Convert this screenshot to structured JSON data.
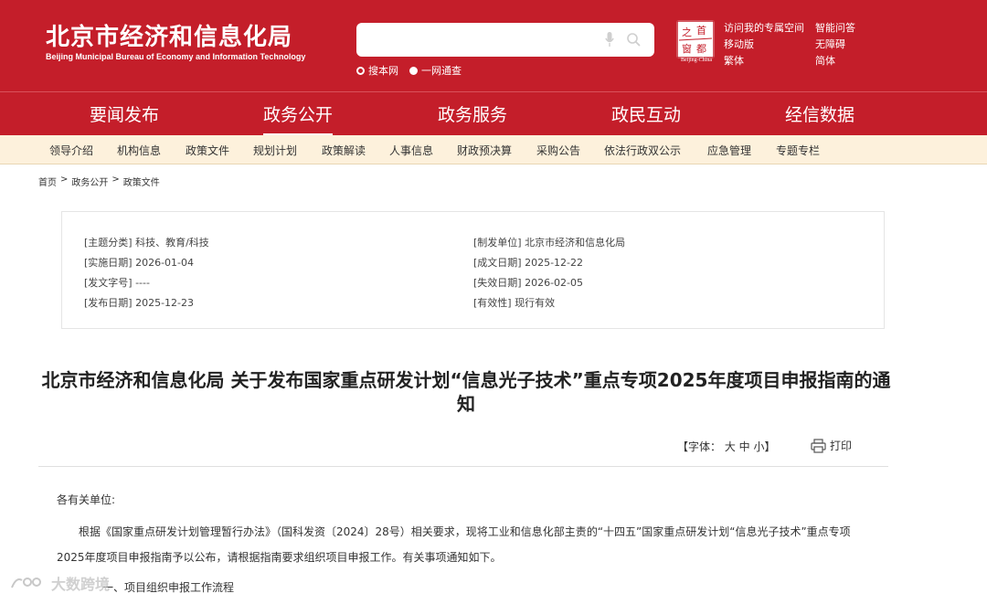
{
  "header": {
    "title_cn": "北京市经济和信息化局",
    "title_en": "Beijing Municipal Bureau of Economy and Information Technology",
    "search": {
      "placeholder": "",
      "options": [
        "搜本网",
        "一网通查"
      ]
    },
    "seal_caption": "Beijing-China",
    "top_links": [
      "访问我的专属空间",
      "智能问答",
      "移动版",
      "无障碍",
      "繁体",
      "简体"
    ],
    "colors": {
      "brand_red": "#c41e2a",
      "subnav_bg": "#fdf1dc"
    }
  },
  "main_nav": [
    "要闻发布",
    "政务公开",
    "政务服务",
    "政民互动",
    "经信数据"
  ],
  "sub_nav": [
    "领导介绍",
    "机构信息",
    "政策文件",
    "规划计划",
    "政策解读",
    "人事信息",
    "财政预决算",
    "采购公告",
    "依法行政双公示",
    "应急管理",
    "专题专栏"
  ],
  "breadcrumb": [
    "首页",
    ">",
    "政务公开",
    ">",
    "政策文件"
  ],
  "info": {
    "topic": "[主题分类] 科技、教育/科技",
    "implement_date": "[实施日期] 2026-01-04",
    "doc_no": "[发文字号] ----",
    "publish_date": "[发布日期] 2025-12-23",
    "issuer": "[制发单位] 北京市经济和信息化局",
    "written_date": "[成文日期] 2025-12-22",
    "expire_date": "[失效日期] 2026-02-05",
    "validity": "[有效性] 现行有效"
  },
  "article": {
    "title": "北京市经济和信息化局 关于发布国家重点研发计划“信息光子技术”重点专项2025年度项目申报指南的通知",
    "font_tools": "【字体：  大  中  小】",
    "print_label": "打印",
    "greeting": "各有关单位:",
    "paragraph": "根据《国家重点研发计划管理暂行办法》（国科发资〔2024〕28号）相关要求，现将工业和信息化部主责的“十四五”国家重点研发计划“信息光子技术”重点专项2025年度项目申报指南予以公布，请根据指南要求组织项目申报工作。有关事项通知如下。",
    "section_heading": "一、项目组织申报工作流程"
  },
  "watermark": "大数跨境"
}
